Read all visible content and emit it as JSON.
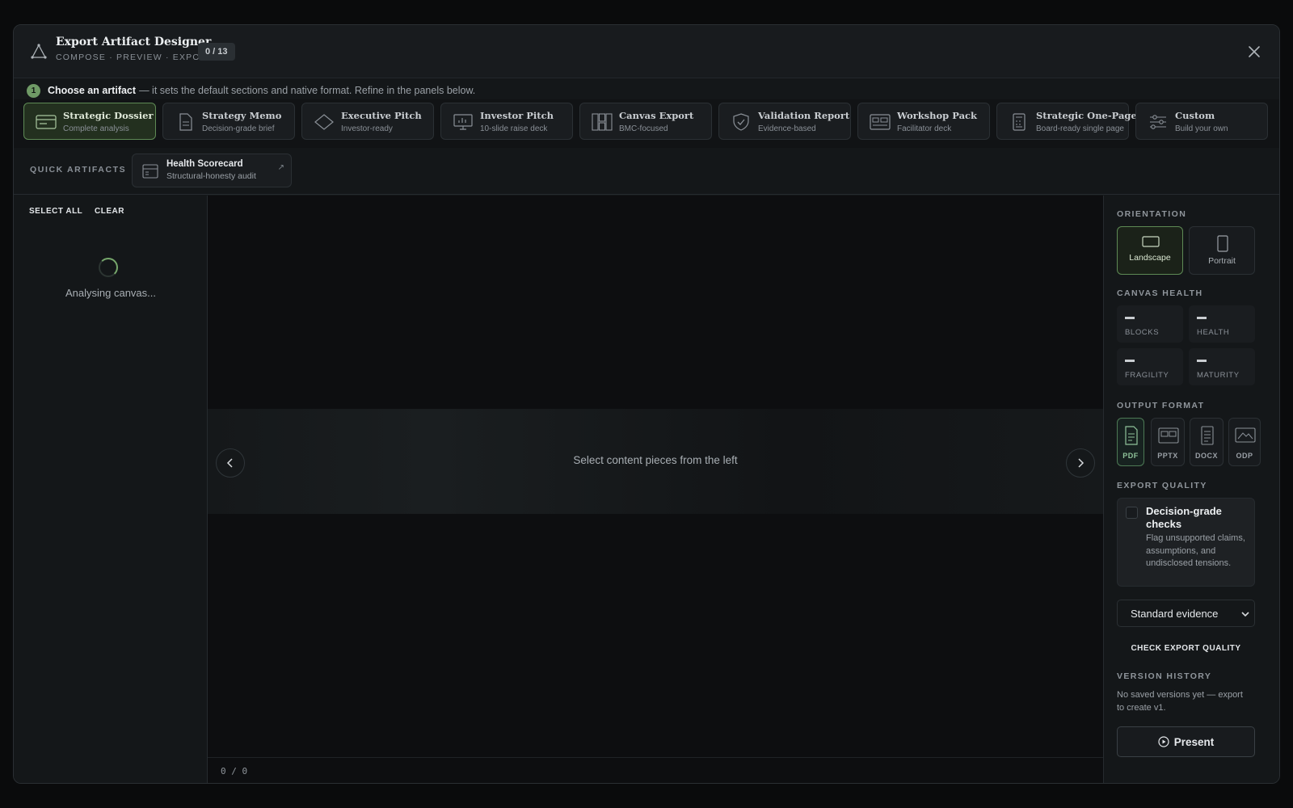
{
  "header": {
    "title": "Export Artifact Designer",
    "subtitle": "COMPOSE · PREVIEW · EXPORT",
    "count": "0 / 13",
    "logo_icon": "triangle-nodes-icon",
    "close_icon": "close-icon"
  },
  "step": {
    "number": "1",
    "strong": "Choose an artifact",
    "rest": "— it sets the default sections and native format. Refine in the panels below."
  },
  "artifacts": [
    {
      "title": "Strategic Dossier",
      "subtitle": "Complete analysis",
      "icon": "dossier-icon",
      "selected": true
    },
    {
      "title": "Strategy Memo",
      "subtitle": "Decision-grade brief",
      "icon": "document-icon",
      "selected": false
    },
    {
      "title": "Executive Pitch",
      "subtitle": "Investor-ready",
      "icon": "diamond-icon",
      "selected": false
    },
    {
      "title": "Investor Pitch",
      "subtitle": "10-slide raise deck",
      "icon": "presentation-icon",
      "selected": false
    },
    {
      "title": "Canvas Export",
      "subtitle": "BMC-focused",
      "icon": "canvas-grid-icon",
      "selected": false
    },
    {
      "title": "Validation Report",
      "subtitle": "Evidence-based",
      "icon": "shield-check-icon",
      "selected": false
    },
    {
      "title": "Workshop Pack",
      "subtitle": "Facilitator deck",
      "icon": "workshop-icon",
      "selected": false
    },
    {
      "title": "Strategic One-Pager",
      "subtitle": "Board-ready single page",
      "icon": "calculator-page-icon",
      "selected": false
    },
    {
      "title": "Custom",
      "subtitle": "Build your own",
      "icon": "sliders-icon",
      "selected": false
    }
  ],
  "quick": {
    "label": "QUICK ARTIFACTS",
    "card_title": "Health Scorecard",
    "card_subtitle": "Structural-honesty audit",
    "arrow": "↗"
  },
  "left": {
    "select_all": "SELECT ALL",
    "clear": "CLEAR",
    "status": "Analysing canvas..."
  },
  "center": {
    "placeholder": "Select content pieces from the left",
    "pager": "0 / 0"
  },
  "right": {
    "orientation_label": "ORIENTATION",
    "orientations": [
      {
        "label": "Landscape",
        "selected": true
      },
      {
        "label": "Portrait",
        "selected": false
      }
    ],
    "health_label": "CANVAS HEALTH",
    "health": [
      {
        "label": "BLOCKS",
        "value": "—"
      },
      {
        "label": "HEALTH",
        "value": "—"
      },
      {
        "label": "FRAGILITY",
        "value": "—"
      },
      {
        "label": "MATURITY",
        "value": "—"
      }
    ],
    "format_label": "OUTPUT FORMAT",
    "formats": [
      {
        "label": "PDF",
        "selected": true
      },
      {
        "label": "PPTX",
        "selected": false
      },
      {
        "label": "DOCX",
        "selected": false
      },
      {
        "label": "ODP",
        "selected": false
      }
    ],
    "quality_label": "EXPORT QUALITY",
    "quality_title": "Decision-grade checks",
    "quality_desc": "Flag unsupported claims, assumptions, and undisclosed tensions.",
    "evidence_select": "Standard evidence",
    "check_button": "CHECK EXPORT QUALITY",
    "version_label": "VERSION HISTORY",
    "version_text": "No saved versions yet — export to create v1.",
    "present_button": "Present"
  },
  "colors": {
    "accent_green": "#6f9a66",
    "background": "#141719",
    "page_background": "#0a0b0c"
  }
}
